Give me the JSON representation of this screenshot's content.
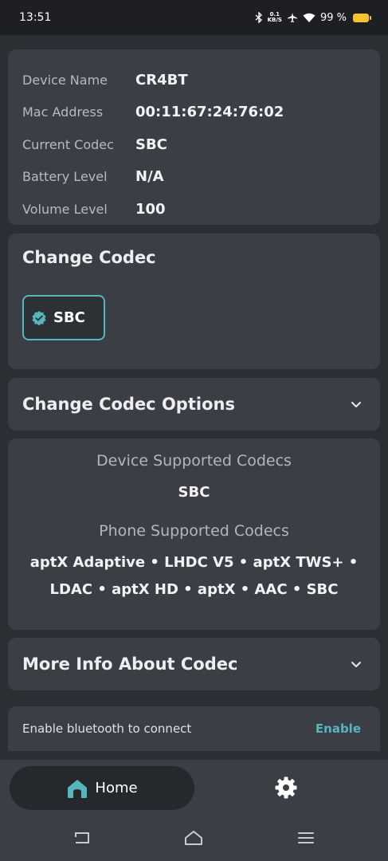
{
  "status": {
    "time": "13:51",
    "netspeed_value": "0.1",
    "netspeed_unit": "KB/S",
    "battery": "99 %"
  },
  "device_info": {
    "rows": [
      {
        "label": "Device Name",
        "value": "CR4BT"
      },
      {
        "label": "Mac Address",
        "value": "00:11:67:24:76:02"
      },
      {
        "label": "Current Codec",
        "value": "SBC"
      },
      {
        "label": "Battery Level",
        "value": "N/A"
      },
      {
        "label": "Volume Level",
        "value": "100"
      }
    ]
  },
  "change_codec": {
    "title": "Change Codec",
    "selected_codec": "SBC"
  },
  "codec_options": {
    "title": "Change Codec Options"
  },
  "supported": {
    "device_heading": "Device Supported Codecs",
    "device_codecs": "SBC",
    "phone_heading": "Phone Supported Codecs",
    "phone_codecs_line1": "aptX Adaptive • LHDC V5 • aptX TWS+ •",
    "phone_codecs_line2": "LDAC • aptX HD • aptX • AAC • SBC"
  },
  "more_info": {
    "title": "More Info About Codec"
  },
  "bluetooth": {
    "message": "Enable bluetooth to connect",
    "action": "Enable"
  },
  "nav": {
    "home_label": "Home"
  },
  "colors": {
    "accent": "#56b6be",
    "card": "#3b3f45",
    "background": "#2b2e33"
  }
}
